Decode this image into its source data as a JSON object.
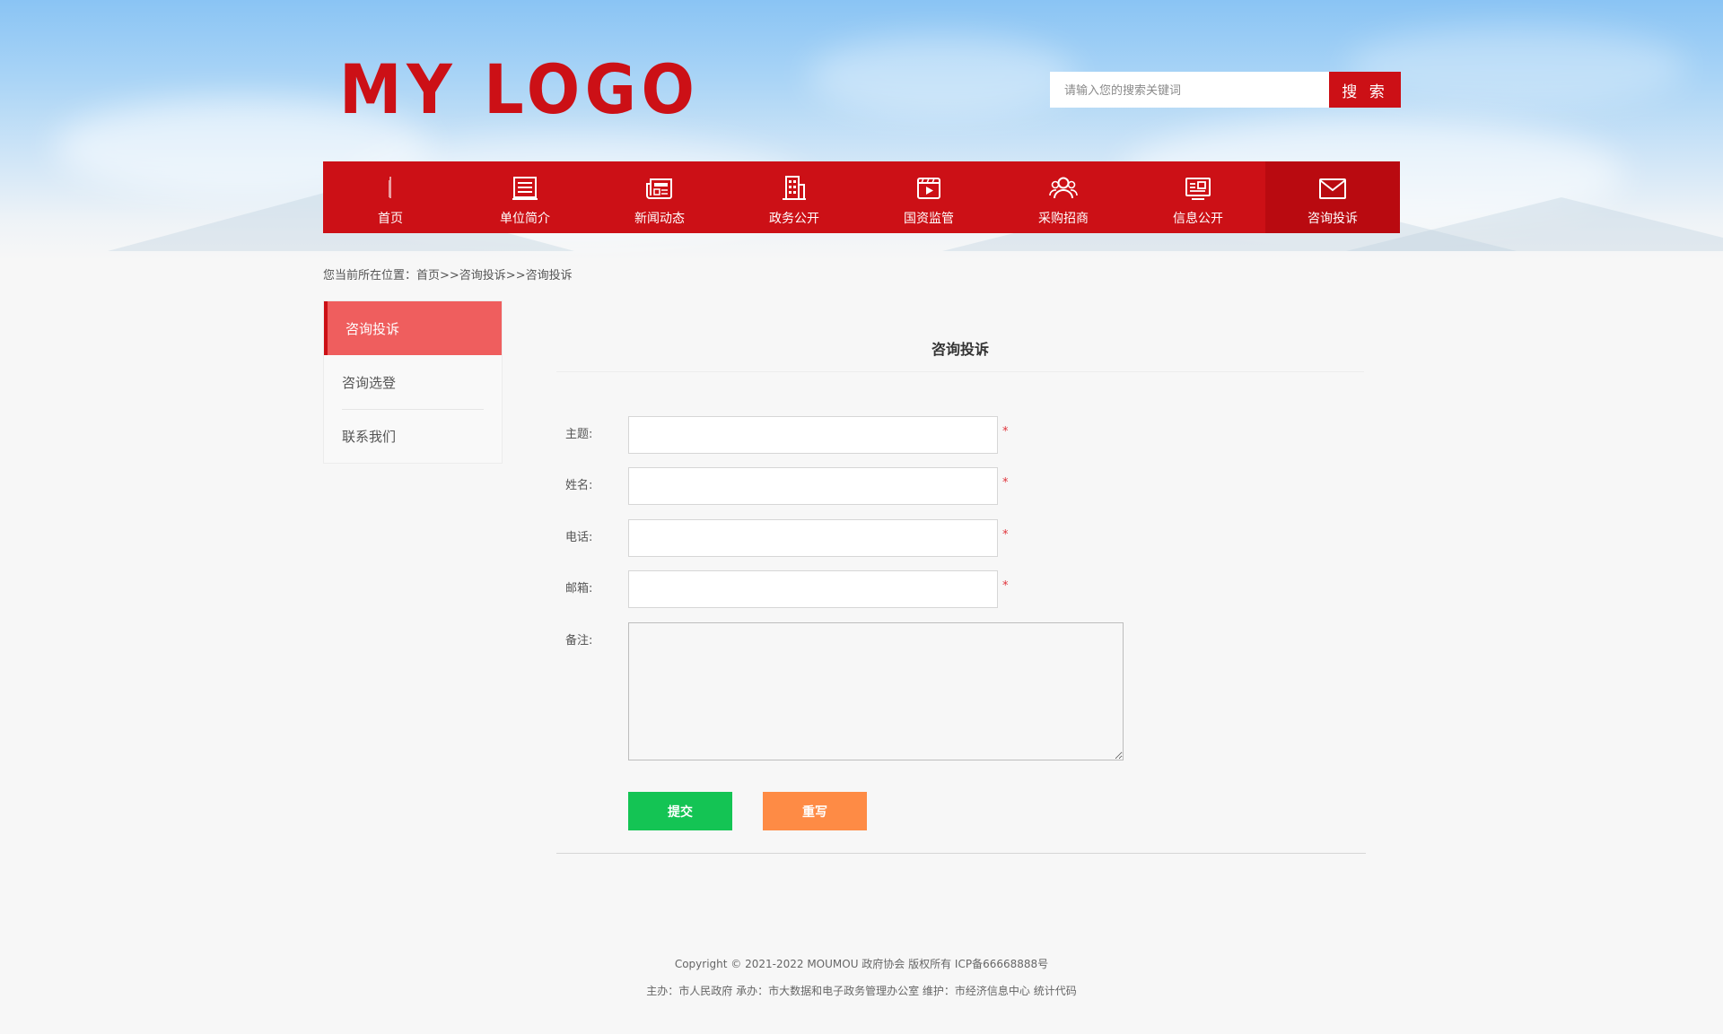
{
  "header": {
    "logo_text": "MY LOGO",
    "search_placeholder": "请输入您的搜索关键词",
    "search_button": "搜 索"
  },
  "nav": {
    "items": [
      {
        "label": "首页",
        "icon": "home-icon"
      },
      {
        "label": "单位简介",
        "icon": "document-icon"
      },
      {
        "label": "新闻动态",
        "icon": "newspaper-icon"
      },
      {
        "label": "政务公开",
        "icon": "building-icon"
      },
      {
        "label": "国资监管",
        "icon": "video-icon"
      },
      {
        "label": "采购招商",
        "icon": "users-icon"
      },
      {
        "label": "信息公开",
        "icon": "info-card-icon"
      },
      {
        "label": "咨询投诉",
        "icon": "mail-icon"
      }
    ],
    "active_index": 7
  },
  "breadcrumb": {
    "prefix": "您当前所在位置：",
    "path": "首页>>咨询投诉>>咨询投诉"
  },
  "sidebar": {
    "items": [
      {
        "label": "咨询投诉",
        "active": true
      },
      {
        "label": "咨询选登",
        "active": false
      },
      {
        "label": "联系我们",
        "active": false
      }
    ]
  },
  "form": {
    "title": "咨询投诉",
    "fields": [
      {
        "label": "主题:",
        "value": "",
        "required_mark": "*"
      },
      {
        "label": "姓名:",
        "value": "",
        "required_mark": "*"
      },
      {
        "label": "电话:",
        "value": "",
        "required_mark": "*"
      },
      {
        "label": "邮箱:",
        "value": "",
        "required_mark": "*"
      }
    ],
    "remarks_label": "备注:",
    "remarks_value": "",
    "submit_label": "提交",
    "reset_label": "重写"
  },
  "footer": {
    "line1": "Copyright © 2021-2022 MOUMOU 政府协会 版权所有 ICP备66668888号",
    "line2": "主办：市人民政府 承办：市大数据和电子政务管理办公室 维护：市经济信息中心 统计代码"
  },
  "colors": {
    "brand_red": "#cc1016",
    "sidebar_active": "#ef5e5e",
    "submit_green": "#14c454",
    "reset_orange": "#fe8b45"
  }
}
